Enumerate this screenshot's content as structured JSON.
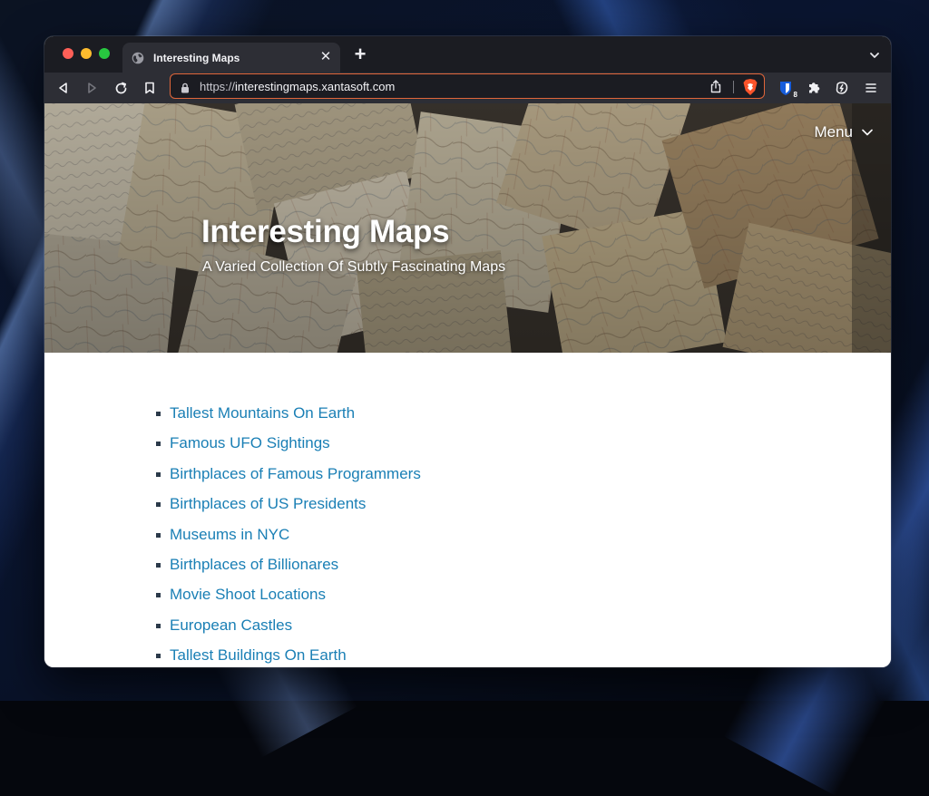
{
  "browser": {
    "tab_title": "Interesting Maps",
    "url_scheme": "https://",
    "url_host": "interestingmaps.xantasoft.com",
    "bitwarden_badge": "8",
    "accent_color": "#e0663a"
  },
  "site": {
    "menu_label": "Menu",
    "title": "Interesting Maps",
    "tagline": "A Varied Collection Of Subtly Fascinating Maps",
    "link_color": "#1a7fb5"
  },
  "links": [
    "Tallest Mountains On Earth",
    "Famous UFO Sightings",
    "Birthplaces of Famous Programmers",
    "Birthplaces of US Presidents",
    "Museums in NYC",
    "Birthplaces of Billionares",
    "Movie Shoot Locations",
    "European Castles",
    "Tallest Buildings On Earth"
  ]
}
